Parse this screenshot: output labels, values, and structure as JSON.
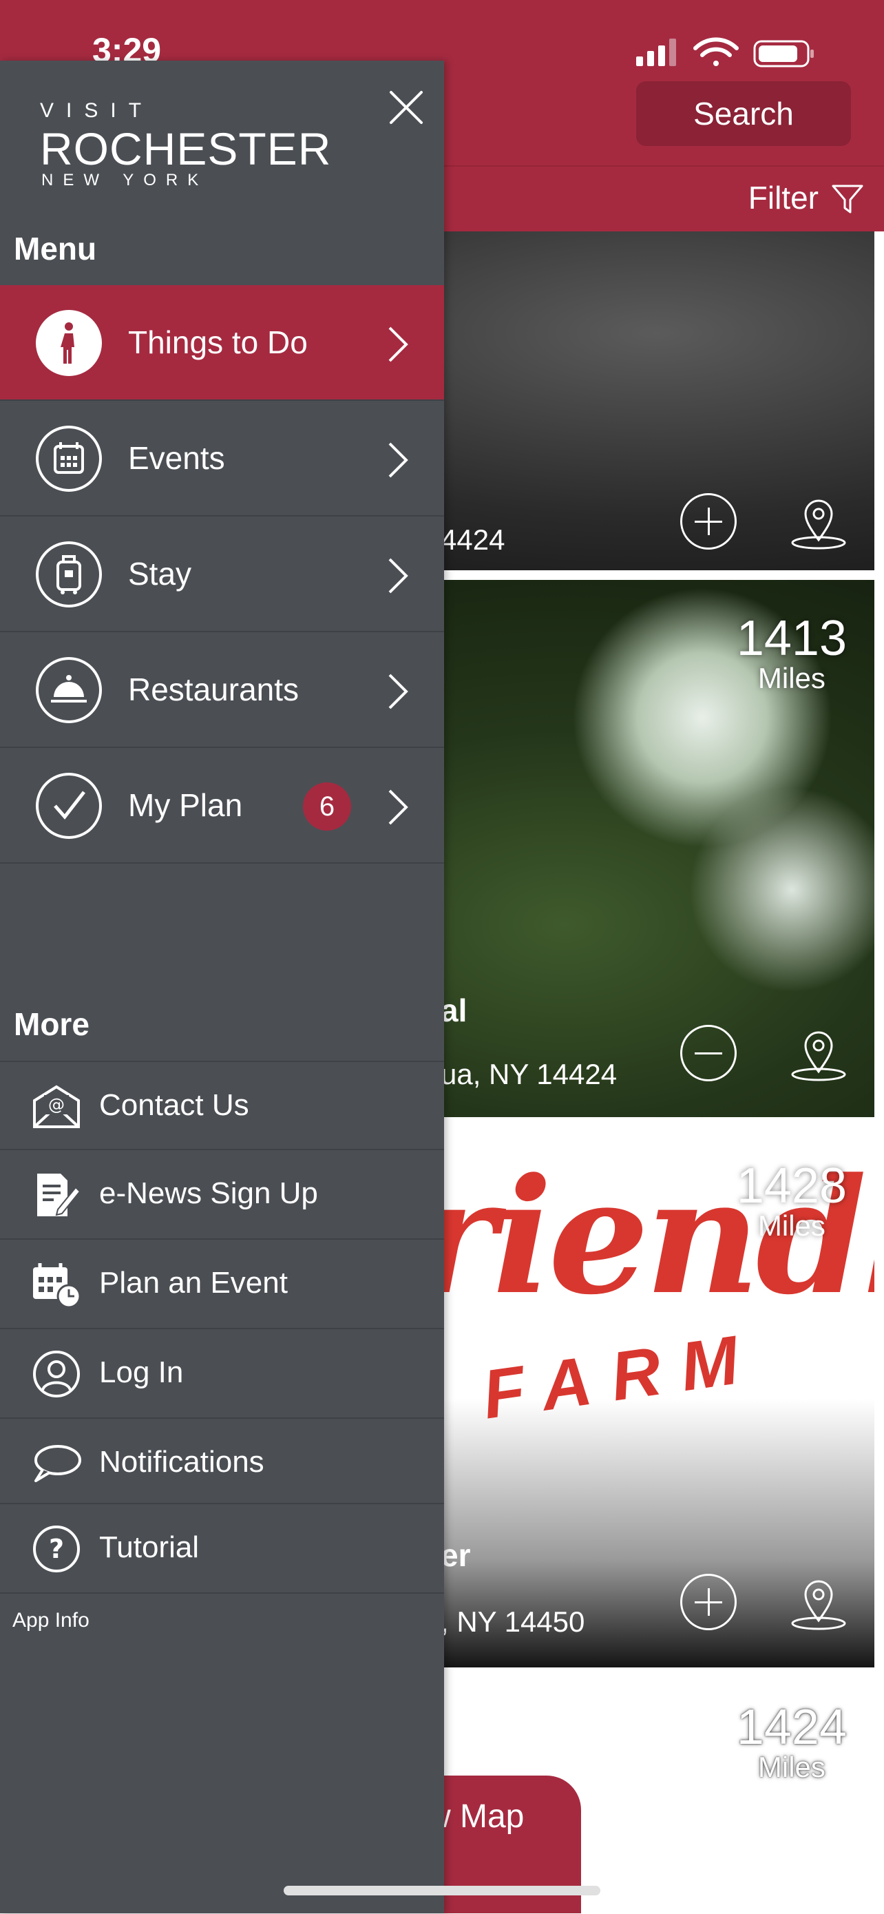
{
  "status_bar": {
    "time": "3:29"
  },
  "header": {
    "search_label": "Search",
    "filter_label": "Filter"
  },
  "cards": [
    {
      "address_fragment": "4424"
    },
    {
      "distance": "1413",
      "unit": "Miles",
      "title_fragment": "al",
      "address_fragment": "ua, NY 14424"
    },
    {
      "distance": "1428",
      "unit": "Miles",
      "title_fragment": "er",
      "address_fragment": ", NY 14450",
      "art_line1": "riendly",
      "art_line2": "FARM"
    },
    {
      "distance": "1424",
      "unit": "Miles"
    }
  ],
  "view_map": {
    "label": "w Map"
  },
  "drawer": {
    "logo": {
      "visit": "VISIT",
      "main": "ROCHESTER",
      "sub": "NEW YORK"
    },
    "menu_heading": "Menu",
    "menu_items": [
      {
        "label": "Things to Do",
        "icon": "walking-person-icon",
        "active": true
      },
      {
        "label": "Events",
        "icon": "calendar-icon"
      },
      {
        "label": "Stay",
        "icon": "luggage-icon"
      },
      {
        "label": "Restaurants",
        "icon": "cloche-icon"
      },
      {
        "label": "My Plan",
        "icon": "checkmark-icon",
        "badge": "6"
      }
    ],
    "more_heading": "More",
    "more_items": [
      {
        "label": "Contact Us",
        "icon": "email-icon"
      },
      {
        "label": "e-News Sign Up",
        "icon": "signup-form-icon"
      },
      {
        "label": "Plan an Event",
        "icon": "calendar-clock-icon"
      },
      {
        "label": "Log In",
        "icon": "user-icon"
      },
      {
        "label": "Notifications",
        "icon": "chat-bubble-icon"
      },
      {
        "label": "Tutorial",
        "icon": "help-icon"
      }
    ],
    "app_info": "App Info"
  },
  "colors": {
    "brand": "#a52a40",
    "drawer": "#4b4f54",
    "divider": "#3e4246"
  }
}
